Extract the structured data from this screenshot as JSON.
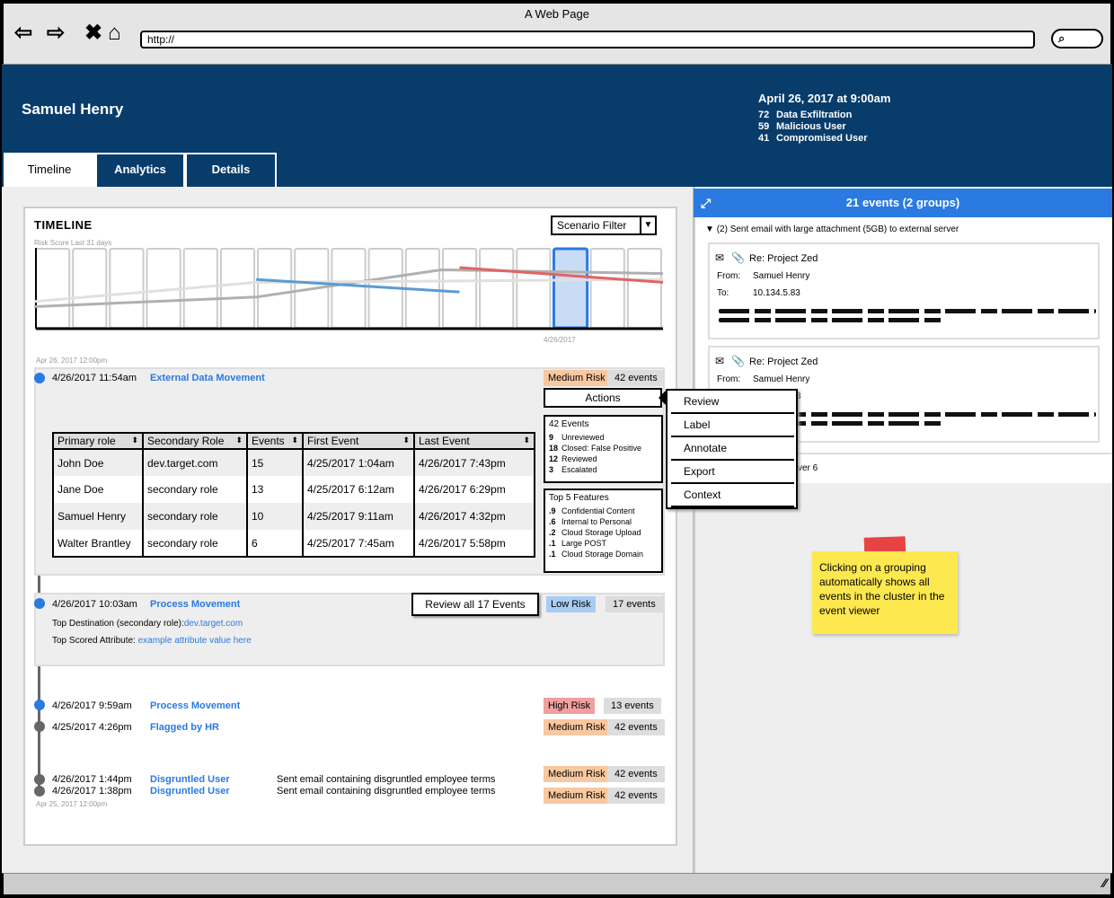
{
  "browser": {
    "window_title": "A Web Page",
    "url": "http://"
  },
  "header": {
    "user_name": "Samuel Henry",
    "date_line": "April 26, 2017 at 9:00am",
    "stats": [
      {
        "count": "72",
        "label": "Data Exfiltration"
      },
      {
        "count": "59",
        "label": "Malicious User"
      },
      {
        "count": "41",
        "label": "Compromised User"
      }
    ],
    "tabs": [
      "Timeline",
      "Analytics",
      "Details"
    ]
  },
  "timeline": {
    "title": "TIMELINE",
    "subtitle": "Risk Score Last 31 days",
    "filter_label": "Scenario Filter",
    "chart_date_label": "4/26/2017",
    "top_date": "Apr 26, 2017 12:00pm",
    "bottom_date": "Apr 25, 2017 12:00pm"
  },
  "chart_data": {
    "type": "line",
    "title": "",
    "xlabel": "",
    "ylabel": "",
    "columns": 17,
    "highlight_column": 14,
    "series": [
      {
        "color": "#b0b0b0",
        "points": [
          [
            0,
            0.25
          ],
          [
            6,
            0.38
          ],
          [
            11,
            0.75
          ],
          [
            17,
            0.7
          ]
        ]
      },
      {
        "color": "#e0e0e0",
        "points": [
          [
            0,
            0.32
          ],
          [
            6,
            0.58
          ],
          [
            17,
            0.62
          ]
        ]
      },
      {
        "color": "#5b9bd5",
        "points": [
          [
            6,
            0.62
          ],
          [
            11.5,
            0.45
          ]
        ]
      },
      {
        "color": "#e06464",
        "points": [
          [
            11.5,
            0.78
          ],
          [
            17,
            0.58
          ]
        ]
      }
    ]
  },
  "event1": {
    "time": "4/26/2017 11:54am",
    "title": "External Data Movement",
    "risk": "Medium Risk",
    "events": "42 events",
    "actions_label": "Actions",
    "summary_title": "42 Events",
    "summary": [
      {
        "n": "9",
        "label": "Unreviewed"
      },
      {
        "n": "18",
        "label": "Closed: False Positive"
      },
      {
        "n": "12",
        "label": "Reviewed"
      },
      {
        "n": "3",
        "label": "Escalated"
      }
    ],
    "features_title": "Top 5 Features",
    "features": [
      {
        "n": ".9",
        "label": "Confidential Content"
      },
      {
        "n": ".6",
        "label": "Internal to Personal"
      },
      {
        "n": ".2",
        "label": "Cloud Storage Upload"
      },
      {
        "n": ".1",
        "label": "Large POST"
      },
      {
        "n": ".1",
        "label": "Cloud Storage Domain"
      }
    ],
    "table": {
      "headers": [
        "Primary role",
        "Secondary Role",
        "Events",
        "First Event",
        "Last Event"
      ],
      "rows": [
        [
          "John Doe",
          "dev.target.com",
          "15",
          "4/25/2017 1:04am",
          "4/26/2017 7:43pm"
        ],
        [
          "Jane Doe",
          "secondary role",
          "13",
          "4/25/2017 6:12am",
          "4/26/2017 6:29pm"
        ],
        [
          "Samuel Henry",
          "secondary role",
          "10",
          "4/25/2017 9:11am",
          "4/26/2017 4:32pm"
        ],
        [
          "Walter Brantley",
          "secondary role",
          "6",
          "4/25/2017 7:45am",
          "4/26/2017 5:58pm"
        ]
      ]
    }
  },
  "menu": [
    "Review",
    "Label",
    "Annotate",
    "Export",
    "Context"
  ],
  "event2": {
    "time": "4/26/2017 10:03am",
    "title": "Process Movement",
    "review_label": "Review all 17 Events",
    "risk": "Low Risk",
    "events": "17 events",
    "dest_label": "Top Destination (secondary role):",
    "dest_value": "dev.target.com",
    "attr_label": "Top Scored Attribute:",
    "attr_value": "example attribute value here"
  },
  "event3": {
    "time": "4/26/2017 9:59am",
    "title": "Process Movement",
    "risk": "High Risk",
    "events": "13 events"
  },
  "event4": {
    "time": "4/25/2017 4:26pm",
    "title": "Flagged by HR",
    "risk": "Medium Risk",
    "events": "42 events"
  },
  "event5": {
    "time": "4/26/2017 1:44pm",
    "title": "Disgruntled User",
    "desc": "Sent email containing disgruntled employee terms",
    "risk": "Medium Risk",
    "events": "42 events"
  },
  "event6": {
    "time": "4/26/2017 1:38pm",
    "title": "Disgruntled User",
    "desc": "Sent email containing disgruntled employee terms",
    "risk": "Medium Risk",
    "events": "42 events"
  },
  "viewer": {
    "header": "21 events (2 groups)",
    "group_title": "(2) Sent email with large attachment (5GB) to external server",
    "mail1": {
      "subject": "Re: Project Zed",
      "from_label": "From:",
      "from": "Samuel Henry",
      "to_label": "To:",
      "to": "10.134.5.83"
    },
    "mail2": {
      "subject": "Re: Project Zed",
      "from_label": "From:",
      "from": "Samuel Henry",
      "to_fragment": "3"
    },
    "collapsed_fragment": "ver 6"
  },
  "sticky_note": "Clicking on a grouping automatically shows all events in the cluster in the event viewer"
}
